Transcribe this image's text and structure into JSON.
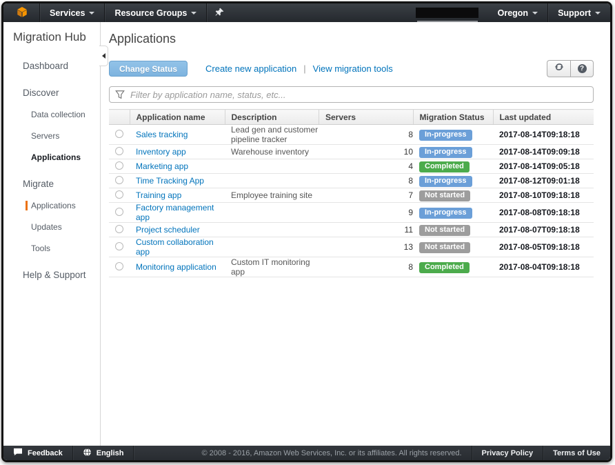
{
  "topnav": {
    "services_label": "Services",
    "resource_groups_label": "Resource Groups",
    "region_label": "Oregon",
    "support_label": "Support"
  },
  "sidebar": {
    "title": "Migration Hub",
    "items": [
      {
        "id": "dashboard",
        "label": "Dashboard",
        "level": 1
      },
      {
        "id": "discover",
        "label": "Discover",
        "level": 1
      },
      {
        "id": "data-collection",
        "label": "Data collection",
        "level": 2
      },
      {
        "id": "servers",
        "label": "Servers",
        "level": 2
      },
      {
        "id": "discover-applications",
        "label": "Applications",
        "level": 2,
        "bold": true
      },
      {
        "id": "migrate",
        "label": "Migrate",
        "level": 1
      },
      {
        "id": "migrate-applications",
        "label": "Applications",
        "level": 2,
        "active": true
      },
      {
        "id": "updates",
        "label": "Updates",
        "level": 2
      },
      {
        "id": "tools",
        "label": "Tools",
        "level": 2
      },
      {
        "id": "help-support",
        "label": "Help & Support",
        "level": 1
      }
    ]
  },
  "main": {
    "page_title": "Applications",
    "toolbar": {
      "change_status_label": "Change Status",
      "create_link_label": "Create new application",
      "separator": "|",
      "view_tools_link_label": "View migration tools"
    },
    "filter": {
      "placeholder": "Filter by application name, status, etc..."
    }
  },
  "table": {
    "columns": [
      "Application name",
      "Description",
      "Servers",
      "Migration Status",
      "Last updated"
    ],
    "rows": [
      {
        "name": "Sales tracking",
        "description": "Lead gen and customer pipeline tracker",
        "servers": "8",
        "status": "In-progress",
        "updated": "2017-08-14T09:18:18"
      },
      {
        "name": "Inventory app",
        "description": "Warehouse inventory",
        "servers": "10",
        "status": "In-progress",
        "updated": "2017-08-14T09:09:18"
      },
      {
        "name": "Marketing app",
        "description": "",
        "servers": "4",
        "status": "Completed",
        "updated": "2017-08-14T09:05:18"
      },
      {
        "name": "Time Tracking App",
        "description": "",
        "servers": "8",
        "status": "In-progress",
        "updated": "2017-08-12T09:01:18"
      },
      {
        "name": "Training app",
        "description": "Employee training site",
        "servers": "7",
        "status": "Not started",
        "updated": "2017-08-10T09:18:18"
      },
      {
        "name": "Factory management app",
        "description": "",
        "servers": "9",
        "status": "In-progress",
        "updated": "2017-08-08T09:18:18"
      },
      {
        "name": "Project scheduler",
        "description": "",
        "servers": "11",
        "status": "Not started",
        "updated": "2017-08-07T09:18:18"
      },
      {
        "name": "Custom collaboration app",
        "description": "",
        "servers": "13",
        "status": "Not started",
        "updated": "2017-08-05T09:18:18"
      },
      {
        "name": "Monitoring application",
        "description": "Custom IT monitoring app",
        "servers": "8",
        "status": "Completed",
        "updated": "2017-08-04T09:18:18"
      }
    ],
    "status_colors": {
      "In-progress": "#6b9fd8",
      "Completed": "#4cab4c",
      "Not started": "#9d9d9d"
    }
  },
  "footer": {
    "feedback_label": "Feedback",
    "language_label": "English",
    "copyright": "© 2008 - 2016, Amazon Web Services, Inc. or its affiliates. All rights reserved.",
    "privacy_label": "Privacy Policy",
    "terms_label": "Terms of Use"
  },
  "colors": {
    "accent_orange": "#ec7211",
    "link_blue": "#0073bb",
    "nav_dark": "#2b2f34"
  },
  "icons": {
    "aws_logo": "orange-cube",
    "pin": "pushpin",
    "refresh": "circular-arrows",
    "help": "question-mark-circle",
    "filter": "funnel",
    "feedback": "speech-bubble",
    "language": "globe",
    "menu_caret": "chevron-down",
    "sidebar_collapse": "chevron-left"
  }
}
